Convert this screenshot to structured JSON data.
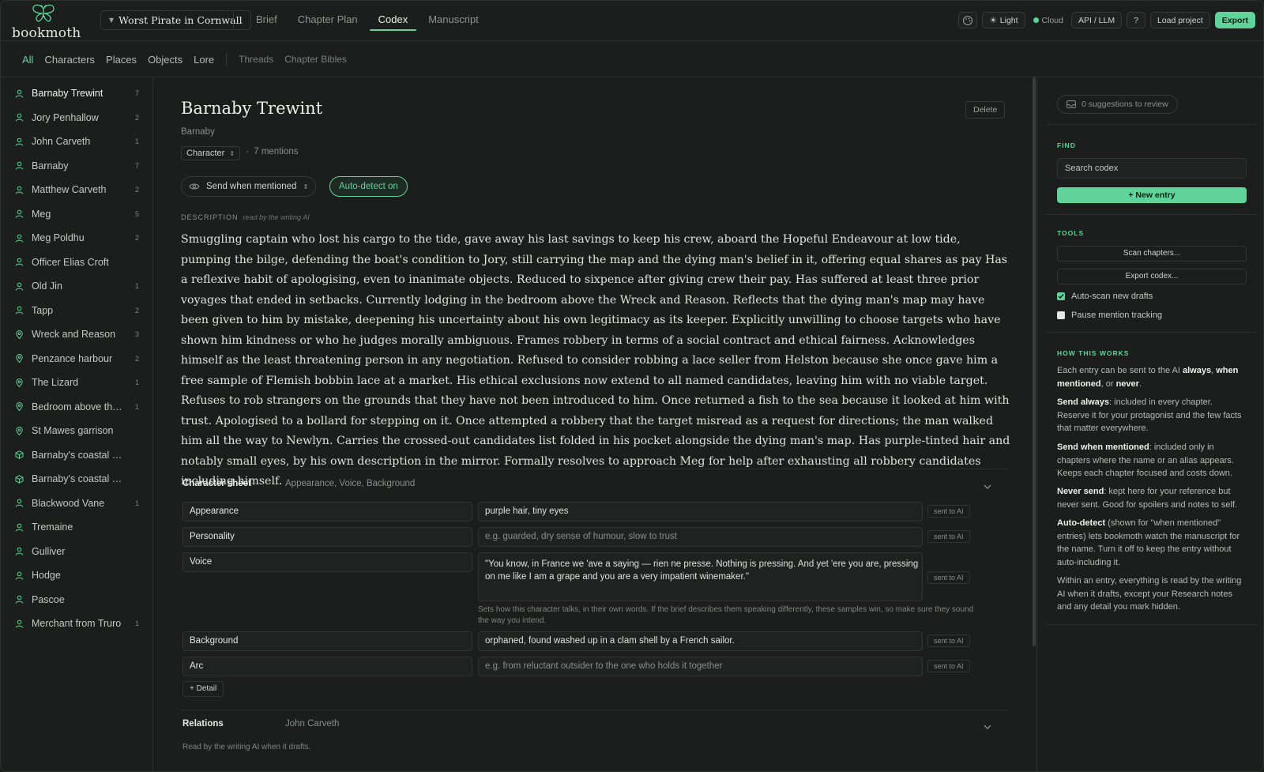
{
  "app": {
    "name": "bookmoth",
    "project": "Worst Pirate in Cornwall"
  },
  "nav": {
    "tabs": [
      "Brief",
      "Chapter Plan",
      "Codex",
      "Manuscript"
    ],
    "active": "Codex"
  },
  "toolbar": {
    "theme_label": "Light",
    "cloud_label": "Cloud",
    "api_label": "API / LLM",
    "help_label": "?",
    "load_label": "Load project",
    "export_label": "Export"
  },
  "filters": {
    "primary": [
      "All",
      "Characters",
      "Places",
      "Objects",
      "Lore"
    ],
    "secondary": [
      "Threads",
      "Chapter Bibles"
    ],
    "active": "All"
  },
  "sidebar": {
    "items": [
      {
        "name": "Barnaby Trewint",
        "count": "7",
        "kind": "character",
        "active": true
      },
      {
        "name": "Jory Penhallow",
        "count": "2",
        "kind": "character"
      },
      {
        "name": "John Carveth",
        "count": "1",
        "kind": "character"
      },
      {
        "name": "Barnaby",
        "count": "7",
        "kind": "character"
      },
      {
        "name": "Matthew Carveth",
        "count": "2",
        "kind": "character"
      },
      {
        "name": "Meg",
        "count": "5",
        "kind": "character"
      },
      {
        "name": "Meg Poldhu",
        "count": "2",
        "kind": "character"
      },
      {
        "name": "Officer Elias Croft",
        "count": "",
        "kind": "character"
      },
      {
        "name": "Old Jin",
        "count": "1",
        "kind": "character"
      },
      {
        "name": "Tapp",
        "count": "2",
        "kind": "character"
      },
      {
        "name": "Wreck and Reason",
        "count": "3",
        "kind": "place"
      },
      {
        "name": "Penzance harbour",
        "count": "2",
        "kind": "place"
      },
      {
        "name": "The Lizard",
        "count": "1",
        "kind": "place"
      },
      {
        "name": "Bedroom above the ...",
        "count": "1",
        "kind": "place"
      },
      {
        "name": "St Mawes garrison",
        "count": "",
        "kind": "place"
      },
      {
        "name": "Barnaby's coastal chart",
        "count": "",
        "kind": "object"
      },
      {
        "name": "Barnaby's coastal chart...",
        "count": "",
        "kind": "object"
      },
      {
        "name": "Blackwood Vane",
        "count": "1",
        "kind": "character"
      },
      {
        "name": "Tremaine",
        "count": "",
        "kind": "character"
      },
      {
        "name": "Gulliver",
        "count": "",
        "kind": "character"
      },
      {
        "name": "Hodge",
        "count": "",
        "kind": "character"
      },
      {
        "name": "Pascoe",
        "count": "",
        "kind": "character"
      },
      {
        "name": "Merchant from Truro",
        "count": "1",
        "kind": "character"
      }
    ]
  },
  "entry": {
    "title": "Barnaby Trewint",
    "alias": "Barnaby",
    "type": "Character",
    "mentions": "7 mentions",
    "delete_label": "Delete",
    "send_mode": "Send when mentioned",
    "autodetect": "Auto-detect on",
    "description_label": "DESCRIPTION",
    "description_note": "read by the writing AI",
    "description": "Smuggling captain who lost his cargo to the tide, gave away his last savings to keep his crew, aboard the Hopeful Endeavour at low tide, pumping the bilge, defending the boat's condition to Jory, still carrying the map and the dying man's belief in it, offering equal shares as pay Has a reflexive habit of apologising, even to inanimate objects. Reduced to sixpence after giving crew their pay. Has suffered at least three prior voyages that ended in setbacks. Currently lodging in the bedroom above the Wreck and Reason. Reflects that the dying man's map may have been given to him by mistake, deepening his uncertainty about his own legitimacy as its keeper. Explicitly unwilling to choose targets who have shown him kindness or who he judges morally ambiguous. Frames robbery in terms of a social contract and ethical fairness. Acknowledges himself as the least threatening person in any negotiation. Refused to consider robbing a lace seller from Helston because she once gave him a free sample of Flemish bobbin lace at a market. His ethical exclusions now extend to all named candidates, leaving him with no viable target. Refuses to rob strangers on the grounds that they have not been introduced to him. Once returned a fish to the sea because it looked at him with trust. Apologised to a bollard for stepping on it. Once attempted a robbery that the target misread as a request for directions; the man walked him all the way to Newlyn. Carries the crossed-out candidates list folded in his pocket alongside the dying man's map. Has purple-tinted hair and notably small eyes, by his own description in the mirror. Formally resolves to approach Meg for help after exhausting all robbery candidates including himself."
  },
  "sheet": {
    "heading": "Character sheet",
    "summary": "Appearance, Voice, Background",
    "sent_label": "sent to AI",
    "fields": [
      {
        "label": "Appearance",
        "value": "purple hair, tiny eyes",
        "placeholder": false
      },
      {
        "label": "Personality",
        "value": "e.g. guarded, dry sense of humour, slow to trust",
        "placeholder": true
      },
      {
        "label": "Voice",
        "value": "\"You know, in France we 'ave a saying — rien ne presse. Nothing is pressing. And yet 'ere you are, pressing on me like I am a grape and you are a very impatient winemaker.\"",
        "placeholder": false
      },
      {
        "label": "Background",
        "value": "orphaned, found washed up in a clam shell by a French sailor.",
        "placeholder": false
      },
      {
        "label": "Arc",
        "value": "e.g. from reluctant outsider to the one who holds it together",
        "placeholder": true
      }
    ],
    "voice_hint": "Sets how this character talks, in their own words. If the brief describes them speaking differently, these samples win, so make sure they sound the way you intend.",
    "add_detail": "+ Detail"
  },
  "relations": {
    "heading": "Relations",
    "summary": "John Carveth",
    "note": "Read by the writing AI when it drafts."
  },
  "panel": {
    "suggestions": "0 suggestions to review",
    "find_label": "FIND",
    "search_value": "Search codex",
    "new_entry": "+ New entry",
    "tools_label": "TOOLS",
    "scan": "Scan chapters...",
    "export_codex": "Export codex...",
    "auto_scan": "Auto-scan new drafts",
    "pause_tracking": "Pause mention tracking",
    "how_label": "HOW THIS WORKS",
    "how_intro_1": "Each entry can be sent to the AI ",
    "how_always": "always",
    "how_comma": ", ",
    "how_when": "when mentioned",
    "how_or": ", or ",
    "how_never": "never",
    "how_dot": ".",
    "send_always_b": "Send always",
    "send_always_t": ": included in every chapter. Reserve it for your protagonist and the few facts that matter everywhere.",
    "send_when_b": "Send when mentioned",
    "send_when_t": ": included only in chapters where the name or an alias appears. Keeps each chapter focused and costs down.",
    "never_b": "Never send",
    "never_t": ": kept here for your reference but never sent. Good for spoilers and notes to self.",
    "auto_b": "Auto-detect",
    "auto_t": " (shown for \"when mentioned\" entries) lets bookmoth watch the manuscript for the name. Turn it off to keep the entry without auto-including it.",
    "within": "Within an entry, everything is read by the writing AI when it drafts, except your Research notes and any detail you mark hidden."
  },
  "colors": {
    "accent": "#5fd39a",
    "background": "#1b1e1c"
  }
}
